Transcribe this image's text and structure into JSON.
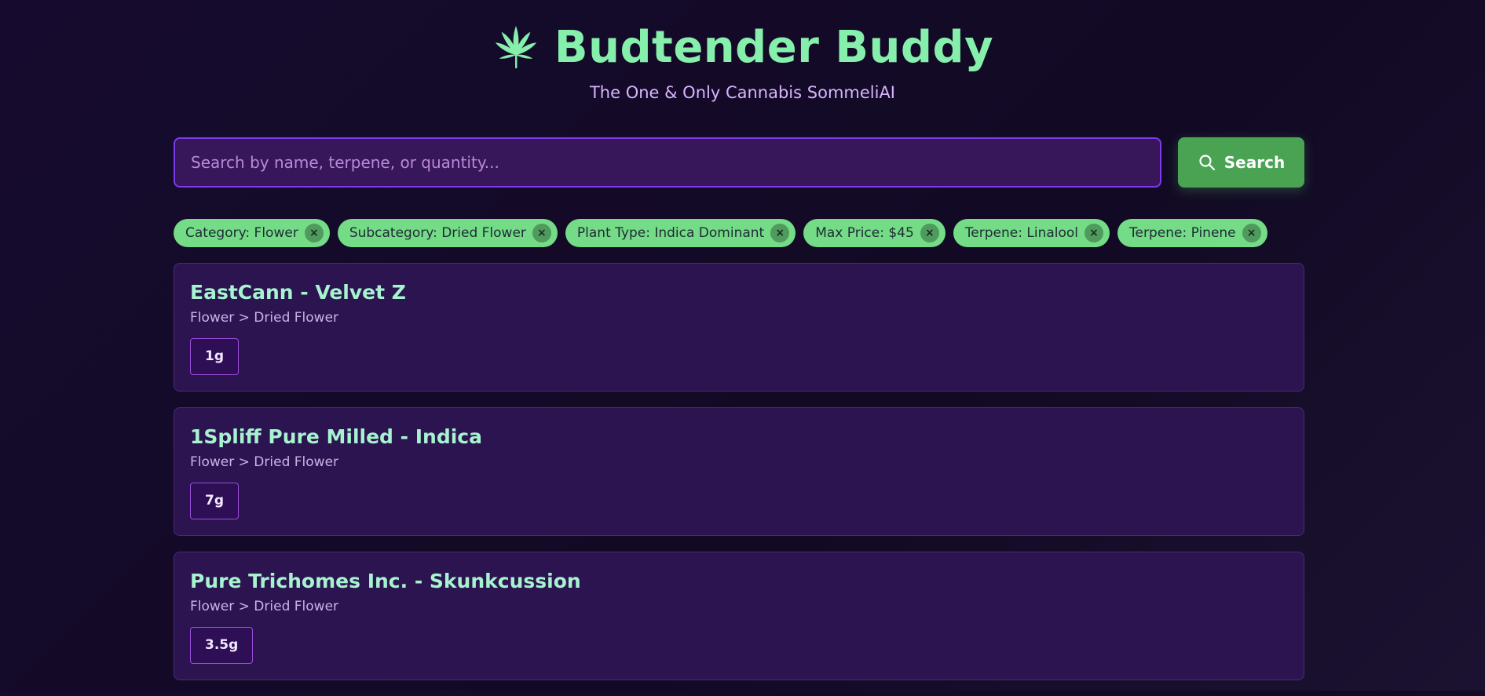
{
  "header": {
    "icon": "cannabis-leaf-icon",
    "title": "Budtender Buddy",
    "subtitle": "The One & Only Cannabis SommeliAI"
  },
  "search": {
    "placeholder": "Search by name, terpene, or quantity...",
    "value": "",
    "button_label": "Search",
    "button_icon": "search-icon"
  },
  "filters": [
    {
      "label": "Category: Flower"
    },
    {
      "label": "Subcategory: Dried Flower"
    },
    {
      "label": "Plant Type: Indica Dominant"
    },
    {
      "label": "Max Price: $45"
    },
    {
      "label": "Terpene: Linalool"
    },
    {
      "label": "Terpene: Pinene"
    }
  ],
  "remove_symbol": "×",
  "products": [
    {
      "name": "EastCann - Velvet Z",
      "category": "Flower > Dried Flower",
      "sizes": [
        "1g"
      ]
    },
    {
      "name": "1Spliff Pure Milled - Indica",
      "category": "Flower > Dried Flower",
      "sizes": [
        "7g"
      ]
    },
    {
      "name": "Pure Trichomes Inc. - Skunkcussion",
      "category": "Flower > Dried Flower",
      "sizes": [
        "3.5g"
      ]
    }
  ],
  "colors": {
    "accent_green": "#86efac",
    "button_green": "#4aa352",
    "chip_green": "#74dc86",
    "purple_border": "#7c3aed",
    "card_bg": "#2b1450"
  }
}
